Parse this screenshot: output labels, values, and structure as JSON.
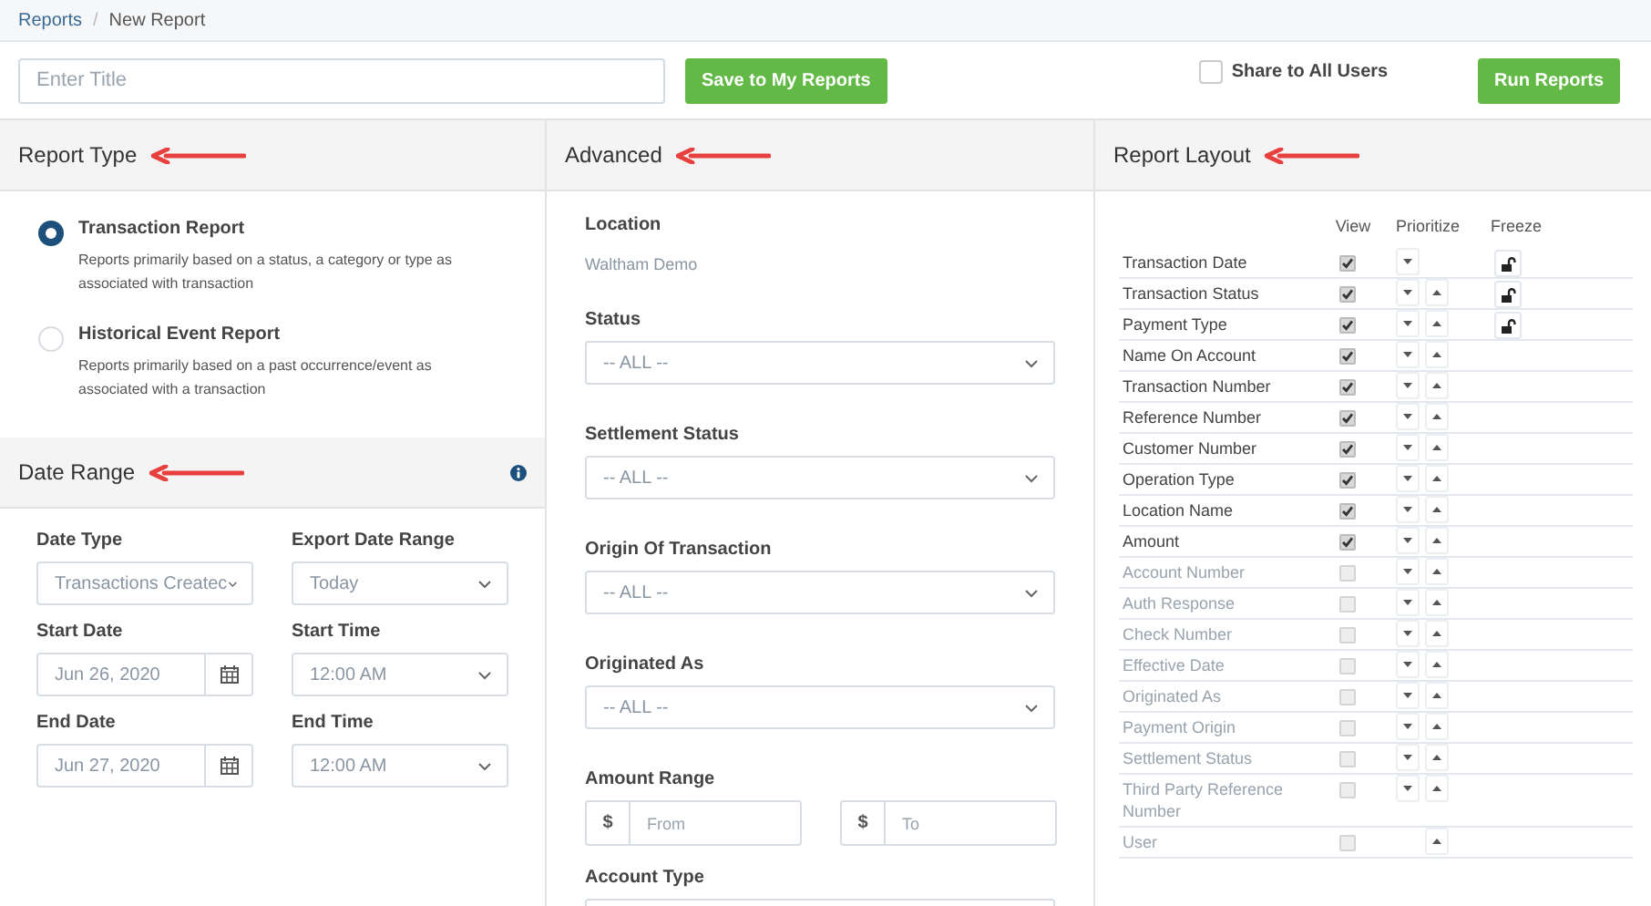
{
  "breadcrumb": [
    {
      "label": "Reports",
      "link": true
    },
    {
      "label": "New Report",
      "link": false
    }
  ],
  "breadcrumb_separator": "/",
  "toolbar": {
    "title_placeholder": "Enter Title",
    "save_button": "Save to My Reports",
    "share": {
      "label": "Share to All Users",
      "checked": false
    },
    "run_button": "Run Reports"
  },
  "report_type": {
    "title": "Report Type",
    "annotated": true,
    "options": [
      {
        "label": "Transaction Report",
        "description": "Reports primarily based on a status, a category or type as associated with transaction",
        "selected": true
      },
      {
        "label": "Historical Event Report",
        "description": "Reports primarily based on a past occurrence/event as associated with a transaction",
        "selected": false
      }
    ]
  },
  "date_range": {
    "title": "Date Range",
    "annotated": true,
    "fields": [
      {
        "label": "Date Type",
        "kind": "select",
        "value": "Transactions Createc"
      },
      {
        "label": "Export Date Range",
        "kind": "select",
        "value": "Today"
      },
      {
        "label": "Start Date",
        "kind": "date",
        "value": "Jun 26, 2020"
      },
      {
        "label": "Start Time",
        "kind": "select",
        "value": "12:00 AM"
      },
      {
        "label": "End Date",
        "kind": "date",
        "value": "Jun 27, 2020"
      },
      {
        "label": "End Time",
        "kind": "select",
        "value": "12:00 AM"
      }
    ]
  },
  "advanced": {
    "title": "Advanced",
    "annotated": true,
    "location": {
      "label": "Location",
      "value": "Waltham Demo"
    },
    "selects": [
      {
        "label": "Status",
        "value": "-- ALL --"
      },
      {
        "label": "Settlement Status",
        "value": "-- ALL --"
      },
      {
        "label": "Origin Of Transaction",
        "value": "-- ALL --"
      },
      {
        "label": "Originated As",
        "value": "-- ALL --"
      }
    ],
    "amount_range": {
      "label": "Amount Range",
      "currency": "$",
      "from_placeholder": "From",
      "to_placeholder": "To"
    },
    "account_type": {
      "label": "Account Type"
    }
  },
  "report_layout": {
    "title": "Report Layout",
    "annotated": true,
    "columns": [
      "View",
      "Prioritize",
      "Freeze"
    ],
    "rows": [
      {
        "label": "Transaction Date",
        "checked": true,
        "down": true,
        "up": false,
        "freezable": true
      },
      {
        "label": "Transaction Status",
        "checked": true,
        "down": true,
        "up": true,
        "freezable": true
      },
      {
        "label": "Payment Type",
        "checked": true,
        "down": true,
        "up": true,
        "freezable": true
      },
      {
        "label": "Name On Account",
        "checked": true,
        "down": true,
        "up": true,
        "freezable": false
      },
      {
        "label": "Transaction Number",
        "checked": true,
        "down": true,
        "up": true,
        "freezable": false
      },
      {
        "label": "Reference Number",
        "checked": true,
        "down": true,
        "up": true,
        "freezable": false
      },
      {
        "label": "Customer Number",
        "checked": true,
        "down": true,
        "up": true,
        "freezable": false
      },
      {
        "label": "Operation Type",
        "checked": true,
        "down": true,
        "up": true,
        "freezable": false
      },
      {
        "label": "Location Name",
        "checked": true,
        "down": true,
        "up": true,
        "freezable": false
      },
      {
        "label": "Amount",
        "checked": true,
        "down": true,
        "up": true,
        "freezable": false
      },
      {
        "label": "Account Number",
        "checked": false,
        "down": true,
        "up": true,
        "freezable": false
      },
      {
        "label": "Auth Response",
        "checked": false,
        "down": true,
        "up": true,
        "freezable": false
      },
      {
        "label": "Check Number",
        "checked": false,
        "down": true,
        "up": true,
        "freezable": false
      },
      {
        "label": "Effective Date",
        "checked": false,
        "down": true,
        "up": true,
        "freezable": false
      },
      {
        "label": "Originated As",
        "checked": false,
        "down": true,
        "up": true,
        "freezable": false
      },
      {
        "label": "Payment Origin",
        "checked": false,
        "down": true,
        "up": true,
        "freezable": false
      },
      {
        "label": "Settlement Status",
        "checked": false,
        "down": true,
        "up": true,
        "freezable": false
      },
      {
        "label": "Third Party Reference Number",
        "checked": false,
        "down": true,
        "up": true,
        "freezable": false
      },
      {
        "label": "User",
        "checked": false,
        "down": false,
        "up": true,
        "freezable": false
      }
    ]
  }
}
